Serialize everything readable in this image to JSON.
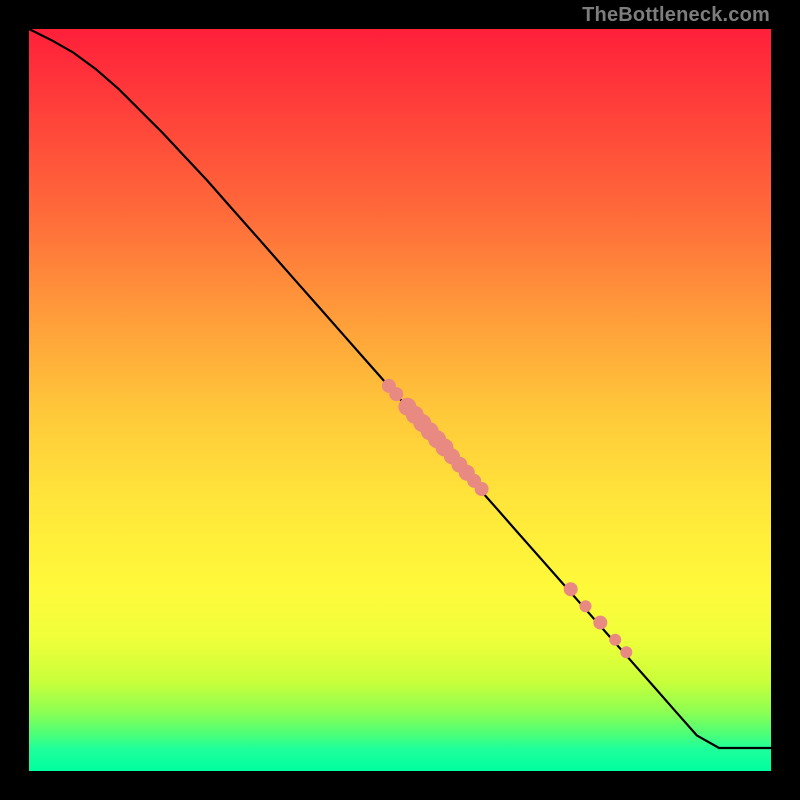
{
  "watermark": "TheBottleneck.com",
  "colors": {
    "background": "#000000",
    "line": "#000000",
    "point_fill": "#e88a82",
    "point_stroke": "#d06e64"
  },
  "chart_data": {
    "type": "line",
    "title": "",
    "xlabel": "",
    "ylabel": "",
    "xlim": [
      0,
      100
    ],
    "ylim": [
      0,
      100
    ],
    "grid": false,
    "legend": false,
    "series": [
      {
        "name": "curve",
        "x": [
          0,
          3,
          6,
          9,
          12,
          15,
          18,
          21,
          24,
          27,
          30,
          33,
          36,
          39,
          42,
          45,
          48,
          51,
          54,
          57,
          60,
          63,
          66,
          69,
          72,
          75,
          78,
          81,
          84,
          87,
          90,
          93,
          100
        ],
        "y": [
          100,
          98.5,
          96.8,
          94.6,
          92.0,
          89.0,
          86.0,
          82.8,
          79.6,
          76.2,
          72.8,
          69.4,
          66.0,
          62.6,
          59.2,
          55.8,
          52.4,
          49.0,
          45.6,
          42.2,
          38.8,
          35.4,
          32.0,
          28.6,
          25.2,
          21.8,
          18.4,
          15.0,
          11.6,
          8.2,
          4.8,
          3.1,
          3.1
        ]
      }
    ],
    "points": {
      "name": "highlighted-points",
      "x": [
        48.5,
        49.5,
        51,
        52,
        53,
        54,
        55,
        56,
        57,
        58,
        59,
        60,
        61,
        73,
        75,
        77,
        79,
        80.5
      ],
      "y": [
        51.9,
        50.8,
        49.1,
        48.0,
        46.9,
        45.8,
        44.7,
        43.6,
        42.4,
        41.3,
        40.2,
        39.1,
        38.0,
        24.5,
        22.2,
        20.0,
        17.7,
        16.0
      ],
      "r": [
        7,
        7,
        9,
        9,
        9,
        9,
        9,
        9,
        8,
        8,
        8,
        7,
        7,
        7,
        6,
        7,
        6,
        6
      ]
    }
  }
}
